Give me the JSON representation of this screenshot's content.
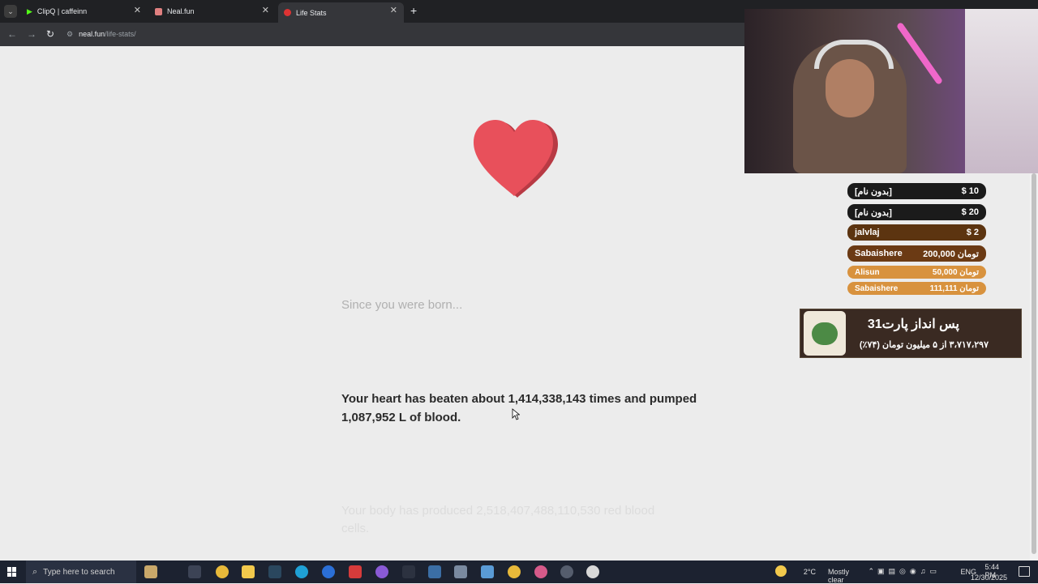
{
  "browser": {
    "tabs": [
      {
        "title": "ClipQ | caffeinn",
        "active": false
      },
      {
        "title": "Neal.fun",
        "active": false
      },
      {
        "title": "Life Stats",
        "active": true
      }
    ],
    "new_tab_label": "+",
    "url_domain": "neal.fun",
    "url_path": "/life-stats/"
  },
  "page": {
    "since_text": "Since you were born...",
    "heart_stat": "Your heart has beaten about 1,414,338,143 times and pumped 1,087,952 L of blood.",
    "body_stat": "Your body has produced 2,518,407,488,110,530 red blood cells.",
    "heart_color": "#e8505b"
  },
  "stream": {
    "donations": [
      {
        "name": "[بدون نام]",
        "amount": "$ 10",
        "color": "#1b1b1b"
      },
      {
        "name": "[بدون نام]",
        "amount": "$ 20",
        "color": "#1b1b1b"
      },
      {
        "name": "jalvlaj",
        "amount": "$ 2",
        "color": "#5c3410"
      },
      {
        "name": "Sabaishere",
        "amount": "200,000 تومان",
        "color": "#6b3a14"
      },
      {
        "name": "Alisun",
        "amount": "50,000 تومان",
        "color": "#d8923e"
      },
      {
        "name": "Sabaishere",
        "amount": "111,111 تومان",
        "color": "#d8923e"
      }
    ],
    "goal_title": "پس انداز پارت31",
    "goal_progress": "۳،۷۱۷،۲۹۷ از ۵ میلیون تومان (۷۴٪)"
  },
  "taskbar": {
    "search_placeholder": "Type here to search",
    "weather_temp": "2°C",
    "weather_desc": "Mostly clear",
    "lang": "ENG",
    "time": "5:44 PM",
    "date": "12/30/2025"
  }
}
